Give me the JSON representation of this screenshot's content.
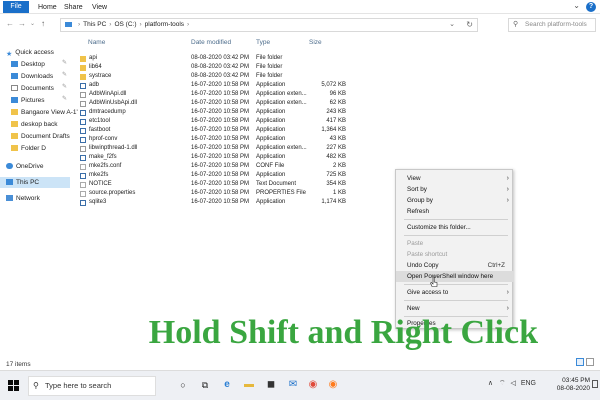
{
  "ribbon": {
    "tabs": [
      "File",
      "Home",
      "Share",
      "View"
    ]
  },
  "address": {
    "segments": [
      "This PC",
      "OS (C:)",
      "platform-tools"
    ]
  },
  "search": {
    "placeholder": "Search platform-tools"
  },
  "nav": {
    "quick_access": "Quick access",
    "items": [
      "Desktop",
      "Downloads",
      "Documents",
      "Pictures",
      "Bangaore View A-1'",
      "deskop back",
      "Document Drafts",
      "Folder D"
    ],
    "onedrive": "OneDrive",
    "this_pc": "This PC",
    "network": "Network"
  },
  "columns": {
    "name": "Name",
    "date": "Date modified",
    "type": "Type",
    "size": "Size"
  },
  "files": [
    {
      "name": "api",
      "date": "08-08-2020 03:42 PM",
      "type": "File folder",
      "size": "",
      "icon": "folder"
    },
    {
      "name": "lib64",
      "date": "08-08-2020 03:42 PM",
      "type": "File folder",
      "size": "",
      "icon": "folder"
    },
    {
      "name": "systrace",
      "date": "08-08-2020 03:42 PM",
      "type": "File folder",
      "size": "",
      "icon": "folder"
    },
    {
      "name": "adb",
      "date": "16-07-2020 10:58 PM",
      "type": "Application",
      "size": "5,072 KB",
      "icon": "app"
    },
    {
      "name": "AdbWinApi.dll",
      "date": "16-07-2020 10:58 PM",
      "type": "Application exten...",
      "size": "96 KB",
      "icon": "dll"
    },
    {
      "name": "AdbWinUsbApi.dll",
      "date": "16-07-2020 10:58 PM",
      "type": "Application exten...",
      "size": "62 KB",
      "icon": "dll"
    },
    {
      "name": "dmtracedump",
      "date": "16-07-2020 10:58 PM",
      "type": "Application",
      "size": "243 KB",
      "icon": "app"
    },
    {
      "name": "etc1tool",
      "date": "16-07-2020 10:58 PM",
      "type": "Application",
      "size": "417 KB",
      "icon": "app"
    },
    {
      "name": "fastboot",
      "date": "16-07-2020 10:58 PM",
      "type": "Application",
      "size": "1,364 KB",
      "icon": "app"
    },
    {
      "name": "hprof-conv",
      "date": "16-07-2020 10:58 PM",
      "type": "Application",
      "size": "43 KB",
      "icon": "app"
    },
    {
      "name": "libwinpthread-1.dll",
      "date": "16-07-2020 10:58 PM",
      "type": "Application exten...",
      "size": "227 KB",
      "icon": "dll"
    },
    {
      "name": "make_f2fs",
      "date": "16-07-2020 10:58 PM",
      "type": "Application",
      "size": "482 KB",
      "icon": "app"
    },
    {
      "name": "mke2fs.conf",
      "date": "16-07-2020 10:58 PM",
      "type": "CONF File",
      "size": "2 KB",
      "icon": "doc"
    },
    {
      "name": "mke2fs",
      "date": "16-07-2020 10:58 PM",
      "type": "Application",
      "size": "725 KB",
      "icon": "app"
    },
    {
      "name": "NOTICE",
      "date": "16-07-2020 10:58 PM",
      "type": "Text Document",
      "size": "354 KB",
      "icon": "doc"
    },
    {
      "name": "source.properties",
      "date": "16-07-2020 10:58 PM",
      "type": "PROPERTIES File",
      "size": "1 KB",
      "icon": "doc"
    },
    {
      "name": "sqlite3",
      "date": "16-07-2020 10:58 PM",
      "type": "Application",
      "size": "1,174 KB",
      "icon": "app"
    }
  ],
  "context_menu": {
    "view": "View",
    "sort_by": "Sort by",
    "group_by": "Group by",
    "refresh": "Refresh",
    "customize": "Customize this folder...",
    "paste": "Paste",
    "paste_shortcut": "Paste shortcut",
    "undo_copy": "Undo Copy",
    "undo_shortcut": "Ctrl+Z",
    "open_powershell": "Open PowerShell window here",
    "give_access": "Give access to",
    "new": "New",
    "properties": "Properties"
  },
  "caption": "Hold Shift and Right Click",
  "status": {
    "items": "17 items"
  },
  "taskbar": {
    "search_placeholder": "Type here to search",
    "tray_lang": "ENG",
    "time": "03:45 PM",
    "date": "08-08-2020"
  },
  "colors": {
    "accent": "#1a6fc9",
    "caption": "#3aa640",
    "folder": "#f0c34a"
  }
}
